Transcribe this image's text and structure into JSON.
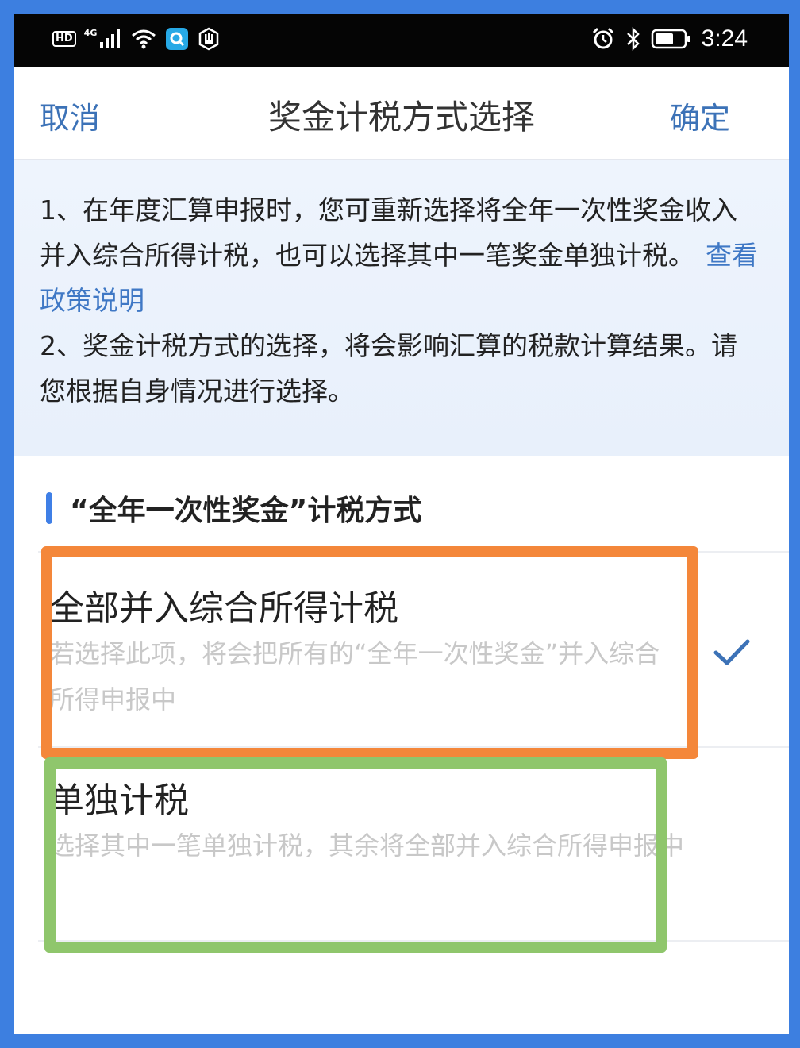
{
  "status_bar": {
    "hd_label": "HD",
    "network_label": "4G",
    "time": "3:24",
    "icons": [
      "signal-icon",
      "wifi-icon",
      "search-app-icon",
      "hand-icon",
      "alarm-icon",
      "bluetooth-icon",
      "battery-icon"
    ]
  },
  "nav": {
    "cancel_label": "取消",
    "title": "奖金计税方式选择",
    "confirm_label": "确定"
  },
  "notice": {
    "line1": "1、在年度汇算申报时，您可重新选择将全年一次性奖金收入并入综合所得计税，也可以选择其中一笔奖金单独计税。",
    "policy_link": "查看政策说明",
    "line2": "2、奖金计税方式的选择，将会影响汇算的税款计算结果。请您根据自身情况进行选择。"
  },
  "section": {
    "title": "“全年一次性奖金”计税方式"
  },
  "options": [
    {
      "title": "全部并入综合所得计税",
      "description": "若选择此项，将会把所有的“全年一次性奖金”并入综合所得申报中",
      "selected": true
    },
    {
      "title": "单独计税",
      "description": "选择其中一笔单独计税，其余将全部并入综合所得申报中",
      "selected": false
    }
  ],
  "colors": {
    "accent": "#3c72b7",
    "highlight_orange": "#f4873a",
    "highlight_green": "#8fc66c"
  }
}
